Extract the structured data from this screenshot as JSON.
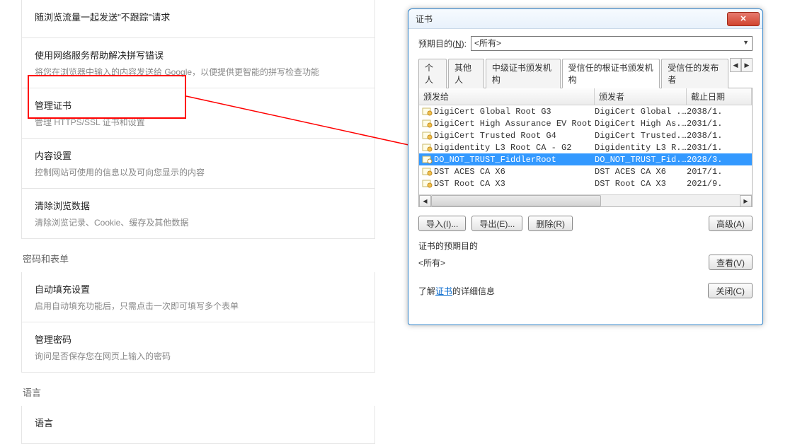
{
  "settings": {
    "items": [
      {
        "title": "随浏览流量一起发送\"不跟踪\"请求",
        "desc": ""
      },
      {
        "title": "使用网络服务帮助解决拼写错误",
        "desc": "将您在浏览器中输入的内容发送给 Google，以便提供更智能的拼写检查功能"
      },
      {
        "title": "管理证书",
        "desc": "管理 HTTPS/SSL 证书和设置"
      },
      {
        "title": "内容设置",
        "desc": "控制网站可使用的信息以及可向您显示的内容"
      },
      {
        "title": "清除浏览数据",
        "desc": "清除浏览记录、Cookie、缓存及其他数据"
      }
    ],
    "section_pwd": "密码和表单",
    "pwd_items": [
      {
        "title": "自动填充设置",
        "desc": "启用自动填充功能后，只需点击一次即可填写多个表单"
      },
      {
        "title": "管理密码",
        "desc": "询问是否保存您在网页上输入的密码"
      }
    ],
    "section_lang": "语言",
    "lang_items": [
      {
        "title": "语言",
        "desc": ""
      }
    ]
  },
  "dialog": {
    "title": "证书",
    "purpose_label_pre": "预期目的(",
    "purpose_label_u": "N",
    "purpose_label_post": "):",
    "purpose_value": "<所有>",
    "tabs": [
      "个人",
      "其他人",
      "中级证书颁发机构",
      "受信任的根证书颁发机构",
      "受信任的发布者"
    ],
    "active_tab": 3,
    "columns": {
      "issued_to": "颁发给",
      "issuer": "颁发者",
      "expiry": "截止日期"
    },
    "rows": [
      {
        "issued": "DigiCert Global Root G3",
        "issuer": "DigiCert Global ...",
        "expiry": "2038/1."
      },
      {
        "issued": "DigiCert High Assurance EV Root CA",
        "issuer": "DigiCert High As...",
        "expiry": "2031/1."
      },
      {
        "issued": "DigiCert Trusted Root G4",
        "issuer": "DigiCert Trusted...",
        "expiry": "2038/1."
      },
      {
        "issued": "Digidentity L3 Root CA - G2",
        "issuer": "Digidentity L3 R...",
        "expiry": "2031/1."
      },
      {
        "issued": "DO_NOT_TRUST_FiddlerRoot",
        "issuer": "DO_NOT_TRUST_Fid...",
        "expiry": "2028/3."
      },
      {
        "issued": "DST ACES CA X6",
        "issuer": "DST ACES CA X6",
        "expiry": "2017/1."
      },
      {
        "issued": "DST Root CA X3",
        "issuer": "DST Root CA X3",
        "expiry": "2021/9."
      }
    ],
    "selected_row": 4,
    "buttons": {
      "import": "导入(I)...",
      "export": "导出(E)...",
      "remove": "删除(R)",
      "advanced": "高级(A)"
    },
    "purpose_section_title": "证书的预期目的",
    "purpose_section_value": "<所有>",
    "view_btn": "查看(V)",
    "footer_pre": "了解",
    "footer_link": "证书",
    "footer_post": "的详细信息",
    "close_btn": "关闭(C)"
  }
}
